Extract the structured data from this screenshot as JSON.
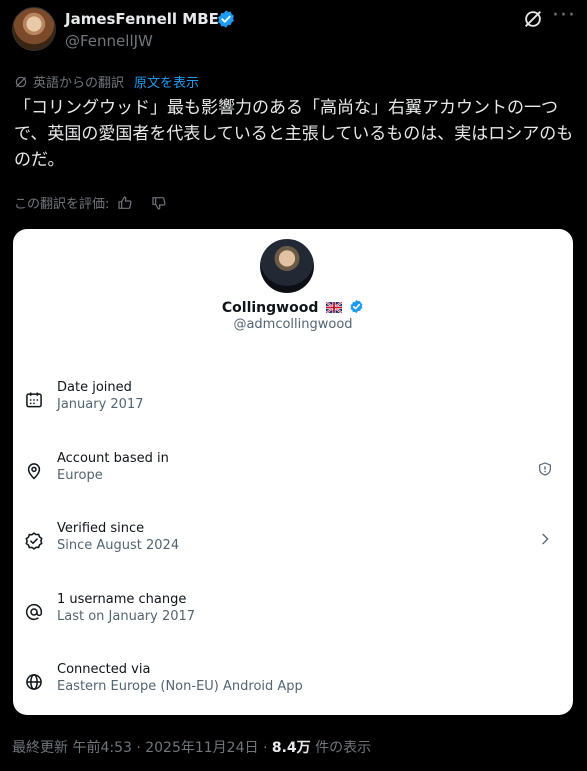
{
  "author": {
    "name": "JamesFennell MBE",
    "handle": "@FennellJW"
  },
  "translation": {
    "label": "英語からの翻訳",
    "show_original": "原文を表示",
    "rate_label": "この翻訳を評価:"
  },
  "tweet": {
    "text": "「コリングウッド」最も影響力のある「高尚な」右翼アカウントの一つで、英国の愛国者を代表していると主張しているものは、実はロシアのものだ。"
  },
  "card": {
    "name": "Collingwood",
    "flag_icon": "uk-flag-icon",
    "handle": "@admcollingwood",
    "rows": [
      {
        "label": "Date joined",
        "value": "January 2017",
        "icon": "calendar-icon"
      },
      {
        "label": "Account based in",
        "value": "Europe",
        "icon": "location-pin-icon",
        "right_icon": "shield-alert-icon"
      },
      {
        "label": "Verified since",
        "value": "Since August 2024",
        "icon": "verified-badge-icon",
        "right_icon": "chevron-right-icon"
      },
      {
        "label": "1 username change",
        "value": "Last on January 2017",
        "icon": "at-sign-icon"
      },
      {
        "label": "Connected via",
        "value": "Eastern Europe (Non-EU) Android App",
        "icon": "globe-icon"
      }
    ]
  },
  "footer": {
    "timestamp": "最終更新 午前4:53 · 2025年11月24日 ·",
    "views": "8.4万",
    "views_label": "件の表示"
  },
  "colors": {
    "background": "#000000",
    "accent": "#1d9bf0",
    "muted": "#71767b",
    "card_bg": "#ffffff"
  }
}
